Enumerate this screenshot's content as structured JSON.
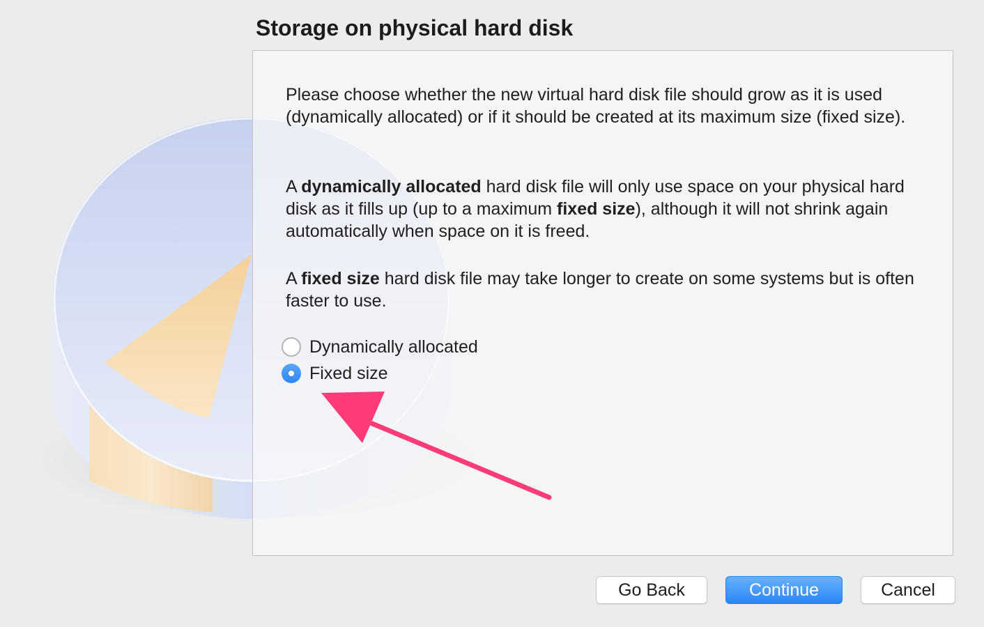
{
  "dialog": {
    "title": "Storage on physical hard disk"
  },
  "description": {
    "para1": "Please choose whether the new virtual hard disk file should grow as it is used (dynamically allocated) or if it should be created at its maximum size (fixed size).",
    "para2": {
      "prefix": "A ",
      "term1": "dynamically allocated",
      "middle": " hard disk file will only use space on your physical hard disk as it fills up (up to a maximum ",
      "term2": "fixed size",
      "suffix": "), although it will not shrink again automatically when space on it is freed."
    },
    "para3": {
      "prefix": "A ",
      "term": "fixed size",
      "suffix": " hard disk file may take longer to create on some systems but is often faster to use."
    }
  },
  "storage_options": [
    {
      "label": "Dynamically allocated",
      "selected": false
    },
    {
      "label": "Fixed size",
      "selected": true
    }
  ],
  "buttons": {
    "go_back": "Go Back",
    "continue": "Continue",
    "cancel": "Cancel"
  },
  "colors": {
    "accent": "#2f86f2",
    "annotation_arrow": "#ff3b78",
    "window_background": "#ececec"
  },
  "icons": {
    "illustration": "hard-disk-icon",
    "annotation": "arrow-annotation-icon"
  }
}
